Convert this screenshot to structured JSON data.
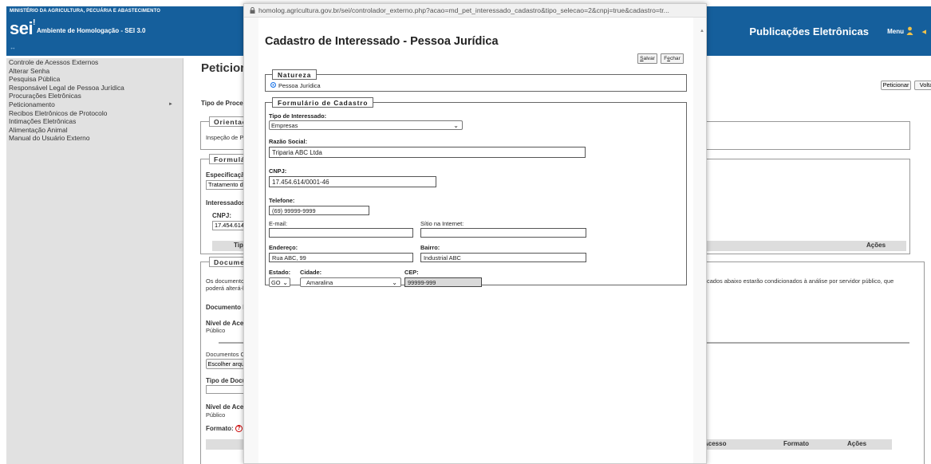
{
  "header": {
    "ministry": "MINISTÉRIO DA AGRICULTURA, PECUÁRIA E ABASTECIMENTO",
    "logo": "sei",
    "environment": "Ambiente de Homologação - SEI 3.0",
    "arrows": "↔",
    "site_title": "Publicações Eletrônicas",
    "menu_label": "Menu",
    "brand_color": "#155f9c"
  },
  "sidebar": {
    "items": [
      {
        "label": "Controle de Acessos Externos"
      },
      {
        "label": "Alterar Senha"
      },
      {
        "label": "Pesquisa Pública"
      },
      {
        "label": "Responsável Legal de Pessoa Jurídica"
      },
      {
        "label": "Procurações Eletrônicas"
      },
      {
        "label": "Peticionamento",
        "submenu": "►"
      },
      {
        "label": "Recibos Eletrônicos de Protocolo"
      },
      {
        "label": "Intimações Eletrônicas"
      },
      {
        "label": "Alimentação Animal"
      },
      {
        "label": "Manual do Usuário Externo"
      }
    ]
  },
  "main": {
    "title": "Peticionam",
    "tipo_processo_label": "Tipo de Processo:",
    "peticionar_button": "Peticionar",
    "voltar_button": "Volta",
    "orientacoes": {
      "legend": "Orientaçõe",
      "text": "Inspeção de Prod"
    },
    "formulario": {
      "legend": "Formulário",
      "especificacao_label": "Especificação (r",
      "especificacao_value": "Tratamento de e",
      "interessados_label": "Interessados:",
      "cnpj_label": "CNPJ:",
      "cnpj_value": "17.454.614/00",
      "tipo_col": "Tipo",
      "acoes_col": "Ações"
    },
    "documentos": {
      "legend": "Documento",
      "text_line1": "Os documentos d",
      "text_line2": "poderá alterá-los",
      "text_right": "cados abaixo estarão condicionados à análise por servidor público, que",
      "doc_principal": "Documento Princ",
      "nivel_acesso_label": "Nível de Acesso:",
      "nivel_acesso_value": "Público",
      "docs_comp": "Documentos Com",
      "escolher_button": "Escolher arquivo",
      "tipo_doc_label": "Tipo de Docume",
      "nivel_acesso2_label": "Nível de Acesso:",
      "nivel_acesso2_value": "Público",
      "formato_label": "Formato:",
      "col_acesso": "Acesso",
      "col_formato": "Formato",
      "col_acoes": "Ações"
    }
  },
  "modal": {
    "url": "homolog.agricultura.gov.br/sei/controlador_externo.php?acao=md_pet_interessado_cadastro&tipo_selecao=2&cnpj=true&cadastro=tr...",
    "title": "Cadastro de Interessado - Pessoa Jurídica",
    "salvar_button": "Salvar",
    "fechar_button": "Fechar",
    "natureza": {
      "legend": "Natureza",
      "option_label": "Pessoa Jurídica",
      "selected": true
    },
    "formulario": {
      "legend": "Formulário de Cadastro",
      "tipo_interessado_label": "Tipo de Interessado:",
      "tipo_interessado_value": "Empresas",
      "razao_social_label": "Razão Social:",
      "razao_social_value": "Triparia ABC Ltda",
      "cnpj_label": "CNPJ:",
      "cnpj_value": "17.454.614/0001-46",
      "telefone_label": "Telefone:",
      "telefone_value": "(69) 99999-9999",
      "email_label": "E-mail:",
      "email_value": "",
      "sitio_label": "Sítio na Internet:",
      "sitio_value": "",
      "endereco_label": "Endereço:",
      "endereco_value": "Rua ABC, 99",
      "bairro_label": "Bairro:",
      "bairro_value": "Industrial ABC",
      "estado_label": "Estado:",
      "estado_value": "GO",
      "cidade_label": "Cidade:",
      "cidade_value": "Amaralina",
      "cep_label": "CEP:",
      "cep_value": "99999-999"
    }
  }
}
